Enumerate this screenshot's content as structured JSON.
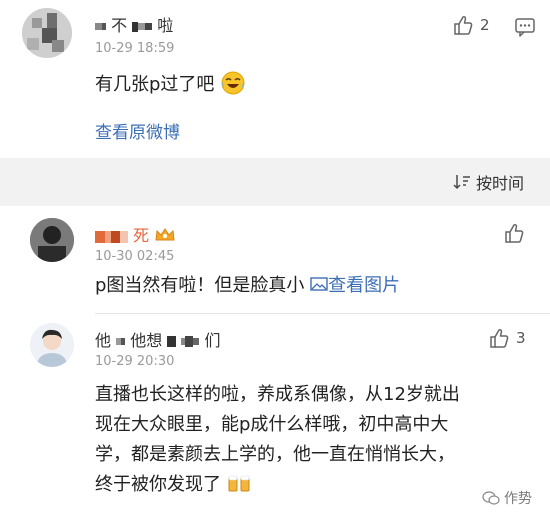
{
  "comment1": {
    "name_prefix": "不",
    "name_suffix": "啦",
    "time": "10-29 18:59",
    "text": "有几张p过了吧",
    "emoji": "laughing-tears",
    "like_count": "2",
    "view_original": "查看原微博"
  },
  "sort": {
    "label": "按时间"
  },
  "reply1": {
    "name_suffix": "死",
    "time": "10-30 02:45",
    "text": "p图当然有啦！但是脸真小",
    "view_image": "查看图片"
  },
  "reply2": {
    "name_prefix": "他",
    "name_middle": "他想",
    "name_suffix": "们",
    "time": "10-29 20:30",
    "like_count": "3",
    "lines": [
      "直播也长这样的啦，养成系偶像，从12岁就出",
      "现在大众眼里，能p成什么样哦，初中高中大",
      "学，都是素颜去上学的，他一直在悄悄长大，",
      "终于被你发现了"
    ]
  },
  "watermark": {
    "text": "作势"
  },
  "colors": {
    "link": "#3d6fb6",
    "band": "#f2f2f2"
  }
}
